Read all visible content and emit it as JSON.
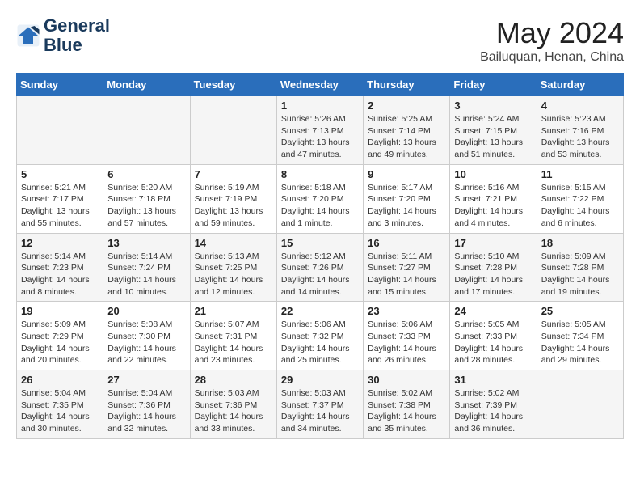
{
  "logo": {
    "line1": "General",
    "line2": "Blue"
  },
  "title": "May 2024",
  "subtitle": "Bailuquan, Henan, China",
  "weekdays": [
    "Sunday",
    "Monday",
    "Tuesday",
    "Wednesday",
    "Thursday",
    "Friday",
    "Saturday"
  ],
  "weeks": [
    [
      {
        "num": "",
        "info": ""
      },
      {
        "num": "",
        "info": ""
      },
      {
        "num": "",
        "info": ""
      },
      {
        "num": "1",
        "info": "Sunrise: 5:26 AM\nSunset: 7:13 PM\nDaylight: 13 hours\nand 47 minutes."
      },
      {
        "num": "2",
        "info": "Sunrise: 5:25 AM\nSunset: 7:14 PM\nDaylight: 13 hours\nand 49 minutes."
      },
      {
        "num": "3",
        "info": "Sunrise: 5:24 AM\nSunset: 7:15 PM\nDaylight: 13 hours\nand 51 minutes."
      },
      {
        "num": "4",
        "info": "Sunrise: 5:23 AM\nSunset: 7:16 PM\nDaylight: 13 hours\nand 53 minutes."
      }
    ],
    [
      {
        "num": "5",
        "info": "Sunrise: 5:21 AM\nSunset: 7:17 PM\nDaylight: 13 hours\nand 55 minutes."
      },
      {
        "num": "6",
        "info": "Sunrise: 5:20 AM\nSunset: 7:18 PM\nDaylight: 13 hours\nand 57 minutes."
      },
      {
        "num": "7",
        "info": "Sunrise: 5:19 AM\nSunset: 7:19 PM\nDaylight: 13 hours\nand 59 minutes."
      },
      {
        "num": "8",
        "info": "Sunrise: 5:18 AM\nSunset: 7:20 PM\nDaylight: 14 hours\nand 1 minute."
      },
      {
        "num": "9",
        "info": "Sunrise: 5:17 AM\nSunset: 7:20 PM\nDaylight: 14 hours\nand 3 minutes."
      },
      {
        "num": "10",
        "info": "Sunrise: 5:16 AM\nSunset: 7:21 PM\nDaylight: 14 hours\nand 4 minutes."
      },
      {
        "num": "11",
        "info": "Sunrise: 5:15 AM\nSunset: 7:22 PM\nDaylight: 14 hours\nand 6 minutes."
      }
    ],
    [
      {
        "num": "12",
        "info": "Sunrise: 5:14 AM\nSunset: 7:23 PM\nDaylight: 14 hours\nand 8 minutes."
      },
      {
        "num": "13",
        "info": "Sunrise: 5:14 AM\nSunset: 7:24 PM\nDaylight: 14 hours\nand 10 minutes."
      },
      {
        "num": "14",
        "info": "Sunrise: 5:13 AM\nSunset: 7:25 PM\nDaylight: 14 hours\nand 12 minutes."
      },
      {
        "num": "15",
        "info": "Sunrise: 5:12 AM\nSunset: 7:26 PM\nDaylight: 14 hours\nand 14 minutes."
      },
      {
        "num": "16",
        "info": "Sunrise: 5:11 AM\nSunset: 7:27 PM\nDaylight: 14 hours\nand 15 minutes."
      },
      {
        "num": "17",
        "info": "Sunrise: 5:10 AM\nSunset: 7:28 PM\nDaylight: 14 hours\nand 17 minutes."
      },
      {
        "num": "18",
        "info": "Sunrise: 5:09 AM\nSunset: 7:28 PM\nDaylight: 14 hours\nand 19 minutes."
      }
    ],
    [
      {
        "num": "19",
        "info": "Sunrise: 5:09 AM\nSunset: 7:29 PM\nDaylight: 14 hours\nand 20 minutes."
      },
      {
        "num": "20",
        "info": "Sunrise: 5:08 AM\nSunset: 7:30 PM\nDaylight: 14 hours\nand 22 minutes."
      },
      {
        "num": "21",
        "info": "Sunrise: 5:07 AM\nSunset: 7:31 PM\nDaylight: 14 hours\nand 23 minutes."
      },
      {
        "num": "22",
        "info": "Sunrise: 5:06 AM\nSunset: 7:32 PM\nDaylight: 14 hours\nand 25 minutes."
      },
      {
        "num": "23",
        "info": "Sunrise: 5:06 AM\nSunset: 7:33 PM\nDaylight: 14 hours\nand 26 minutes."
      },
      {
        "num": "24",
        "info": "Sunrise: 5:05 AM\nSunset: 7:33 PM\nDaylight: 14 hours\nand 28 minutes."
      },
      {
        "num": "25",
        "info": "Sunrise: 5:05 AM\nSunset: 7:34 PM\nDaylight: 14 hours\nand 29 minutes."
      }
    ],
    [
      {
        "num": "26",
        "info": "Sunrise: 5:04 AM\nSunset: 7:35 PM\nDaylight: 14 hours\nand 30 minutes."
      },
      {
        "num": "27",
        "info": "Sunrise: 5:04 AM\nSunset: 7:36 PM\nDaylight: 14 hours\nand 32 minutes."
      },
      {
        "num": "28",
        "info": "Sunrise: 5:03 AM\nSunset: 7:36 PM\nDaylight: 14 hours\nand 33 minutes."
      },
      {
        "num": "29",
        "info": "Sunrise: 5:03 AM\nSunset: 7:37 PM\nDaylight: 14 hours\nand 34 minutes."
      },
      {
        "num": "30",
        "info": "Sunrise: 5:02 AM\nSunset: 7:38 PM\nDaylight: 14 hours\nand 35 minutes."
      },
      {
        "num": "31",
        "info": "Sunrise: 5:02 AM\nSunset: 7:39 PM\nDaylight: 14 hours\nand 36 minutes."
      },
      {
        "num": "",
        "info": ""
      }
    ]
  ]
}
